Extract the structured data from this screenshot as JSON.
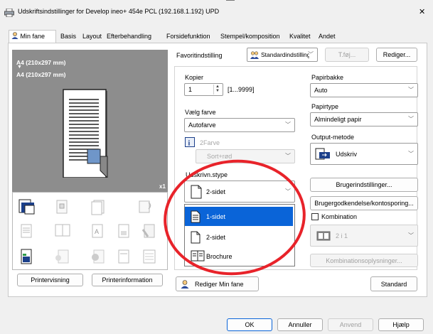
{
  "window": {
    "title": "Udskriftsindstillinger for Develop ineo+ 454e PCL (192.168.1.192) UPD",
    "close_glyph": "✕"
  },
  "tabs": [
    "Min fane",
    "Basis",
    "Layout",
    "Efterbehandling",
    "Forsidefunktion",
    "Stempel/komposition",
    "Kvalitet",
    "Andet"
  ],
  "preview": {
    "paper_from": "A4 (210x297 mm)",
    "arrow": "▼",
    "paper_to": "A4 (210x297 mm)",
    "copies_badge": "x1"
  },
  "left_buttons": {
    "print_preview": "Printervisning",
    "printer_info": "Printerinformation"
  },
  "favorites": {
    "label": "Favoritindstilling",
    "value": "Standardindstilling",
    "add": "T.føj...",
    "edit": "Rediger..."
  },
  "copies": {
    "label": "Kopier",
    "value": "1",
    "range": "[1...9999]"
  },
  "color": {
    "label": "Vælg farve",
    "value": "Autofarve",
    "twocolor_label": "2Farve",
    "twocolor_value": "Sort+rød"
  },
  "print_type": {
    "label": "Udskrivn.stype",
    "value": "2-sidet",
    "options": [
      "1-sidet",
      "2-sidet",
      "Brochure"
    ],
    "selected_index": 0
  },
  "paper_tray": {
    "label": "Papirbakke",
    "value": "Auto"
  },
  "paper_type": {
    "label": "Papirtype",
    "value": "Almindeligt papir"
  },
  "output": {
    "label": "Output-metode",
    "value": "Udskriv"
  },
  "right_buttons": {
    "user_settings": "Brugerindstillinger...",
    "user_auth": "Brugergodkendelse/kontosporing..."
  },
  "combination": {
    "label": "Kombination",
    "value": "2 i 1",
    "details": "Kombinationsoplysninger..."
  },
  "bottom": {
    "edit_tab": "Rediger Min fane",
    "standard": "Standard"
  },
  "dialog_buttons": {
    "ok": "OK",
    "cancel": "Annuller",
    "apply": "Anvend",
    "help": "Hjælp"
  },
  "colors": {
    "highlight": "#0a64d8",
    "annotation": "#e8232a"
  }
}
